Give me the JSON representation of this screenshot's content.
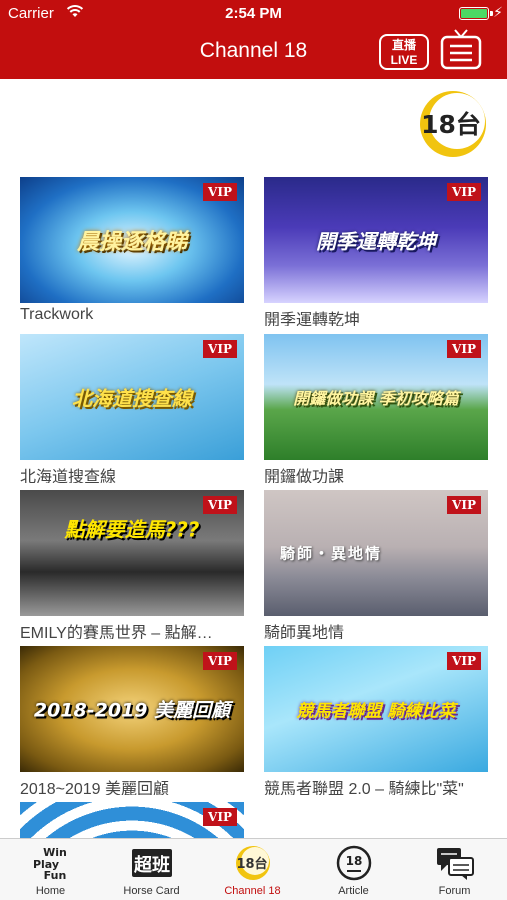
{
  "status": {
    "carrier": "Carrier",
    "time": "2:54 PM"
  },
  "header": {
    "title": "Channel 18",
    "live_label_top": "直播",
    "live_label_bottom": "LIVE"
  },
  "logo": {
    "text": "18台"
  },
  "videos": [
    {
      "caption": "Trackwork",
      "vip": "VIP",
      "overlay": "晨操逐格睇"
    },
    {
      "caption": "開季運轉乾坤",
      "vip": "VIP",
      "overlay": "開季運轉乾坤"
    },
    {
      "caption": "北海道搜查線",
      "vip": "VIP",
      "overlay": "北海道搜查線"
    },
    {
      "caption": "開鑼做功課",
      "vip": "VIP",
      "overlay": "開鑼做功課 季初攻略篇"
    },
    {
      "caption": "EMILY的賽馬世界 – 點解…",
      "vip": "VIP",
      "overlay": "點解要造馬???"
    },
    {
      "caption": "騎師異地情",
      "vip": "VIP",
      "overlay": "騎師・異地情"
    },
    {
      "caption": "2018~2019 美麗回顧",
      "vip": "VIP",
      "overlay": "2018-2019 美麗回顧"
    },
    {
      "caption": "競馬者聯盟 2.0 – 騎練比\"菜\"",
      "vip": "VIP",
      "overlay": "競馬者聯盟 騎練比菜"
    },
    {
      "caption": "",
      "vip": "VIP",
      "overlay": ""
    }
  ],
  "tabs": [
    {
      "label": "Home",
      "icon": "winplayfun-icon",
      "icon_text": "Win Play Fun"
    },
    {
      "label": "Horse Card",
      "icon": "horse-card-icon",
      "icon_text": "超班"
    },
    {
      "label": "Channel 18",
      "icon": "channel18-icon",
      "icon_text": "18台"
    },
    {
      "label": "Article",
      "icon": "article-icon",
      "icon_text": "18"
    },
    {
      "label": "Forum",
      "icon": "forum-icon",
      "icon_text": ""
    }
  ],
  "colors": {
    "brand": "#c20e0e",
    "vip": "#c0121a",
    "active_tab": "#c20e0e"
  }
}
